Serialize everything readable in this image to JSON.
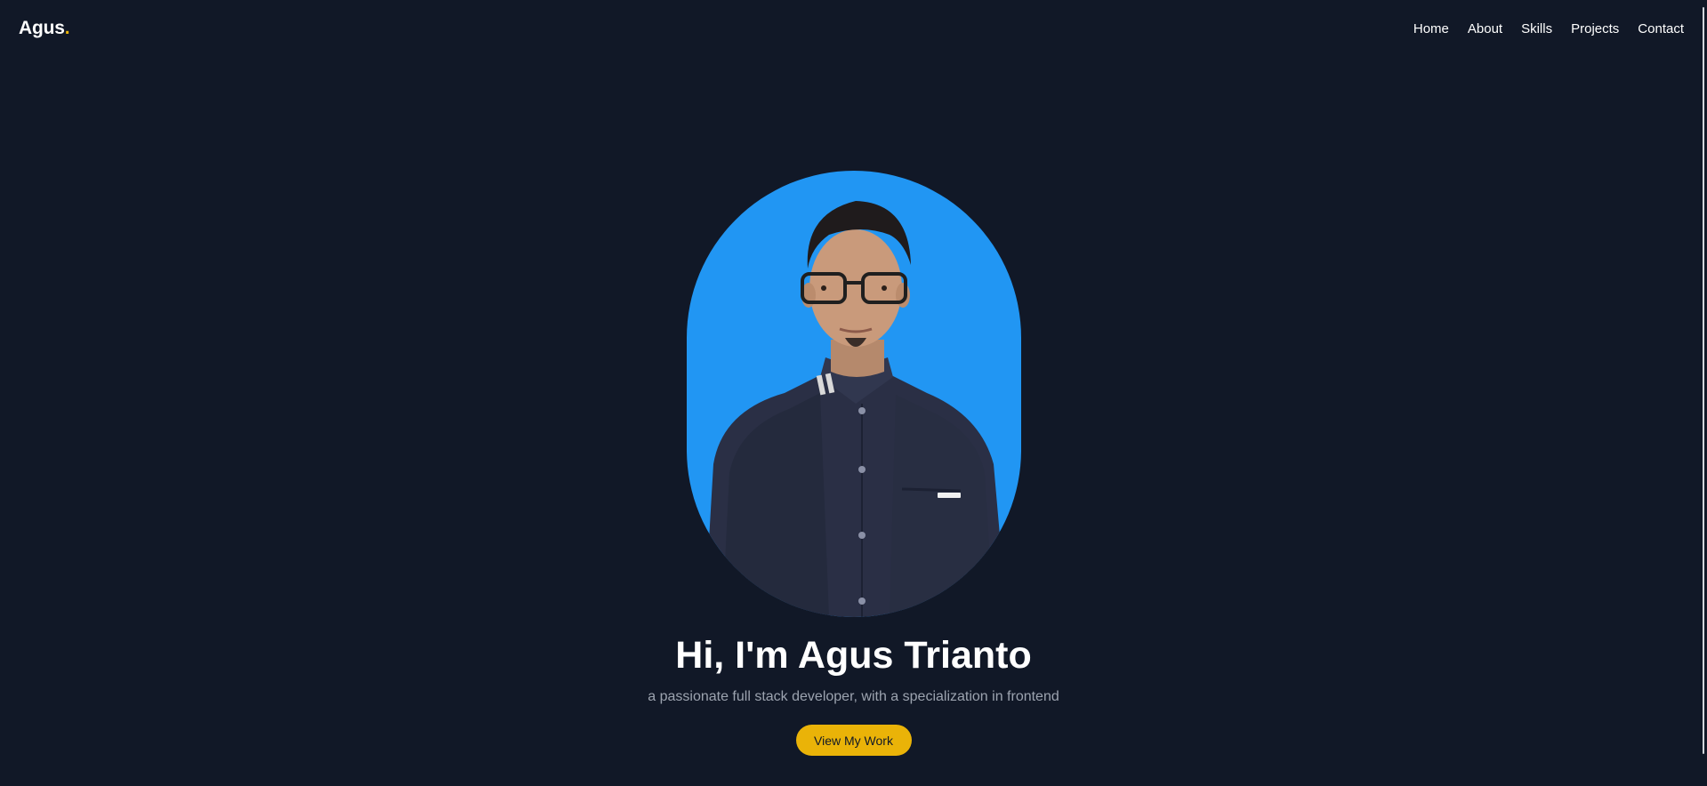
{
  "navbar": {
    "logo_text": "Agus",
    "logo_dot": ".",
    "links": [
      {
        "label": "Home"
      },
      {
        "label": "About"
      },
      {
        "label": "Skills"
      },
      {
        "label": "Projects"
      },
      {
        "label": "Contact"
      }
    ]
  },
  "hero": {
    "title": "Hi, I'm Agus Trianto",
    "subtitle": "a passionate full stack developer, with a specialization in frontend",
    "cta_label": "View My Work",
    "portrait_icon": "profile-photo"
  },
  "colors": {
    "background": "#111827",
    "accent": "#eab308",
    "portrait_bg": "#2196f3",
    "text_primary": "#ffffff",
    "text_muted": "#9ca3af"
  }
}
